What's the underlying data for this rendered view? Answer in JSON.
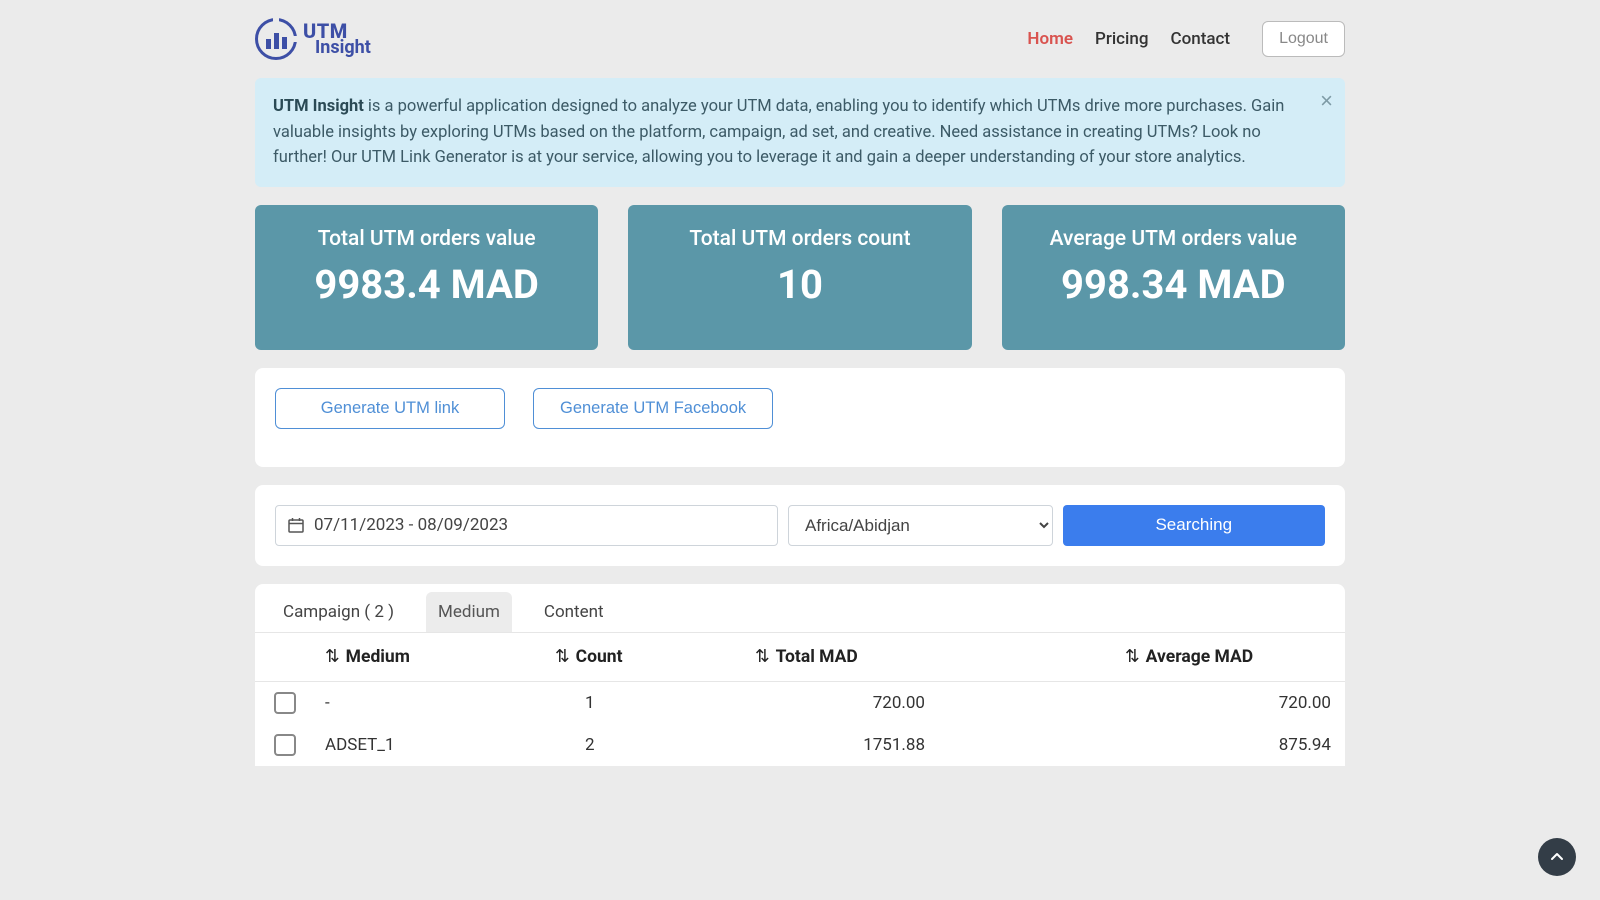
{
  "logo": {
    "line1": "UTM",
    "line2": "Insight"
  },
  "nav": {
    "home": "Home",
    "pricing": "Pricing",
    "contact": "Contact",
    "logout": "Logout"
  },
  "alert": {
    "strong": "UTM Insight",
    "text": " is a powerful application designed to analyze your UTM data, enabling you to identify which UTMs drive more purchases. Gain valuable insights by exploring UTMs based on the platform, campaign, ad set, and creative. Need assistance in creating UTMs? Look no further! Our UTM Link Generator is at your service, allowing you to leverage it and gain a deeper understanding of your store analytics."
  },
  "stats": {
    "card1_title": "Total UTM orders value",
    "card1_value": "9983.4 MAD",
    "card2_title": "Total UTM orders count",
    "card2_value": "10",
    "card3_title": "Average UTM orders value",
    "card3_value": "998.34 MAD"
  },
  "generate": {
    "utm_link": "Generate UTM link",
    "utm_fb": "Generate UTM Facebook"
  },
  "filters": {
    "date_range": "07/11/2023 - 08/09/2023",
    "timezone": "Africa/Abidjan",
    "search_btn": "Searching"
  },
  "tabs": {
    "campaign": "Campaign ( 2 )",
    "medium": "Medium",
    "content": "Content"
  },
  "table": {
    "headers": {
      "medium": "Medium",
      "count": "Count",
      "total": "Total MAD",
      "average": "Average MAD"
    },
    "rows": [
      {
        "medium": "-",
        "count": "1",
        "total": "720.00",
        "average": "720.00"
      },
      {
        "medium": "ADSET_1",
        "count": "2",
        "total": "1751.88",
        "average": "875.94"
      }
    ]
  }
}
